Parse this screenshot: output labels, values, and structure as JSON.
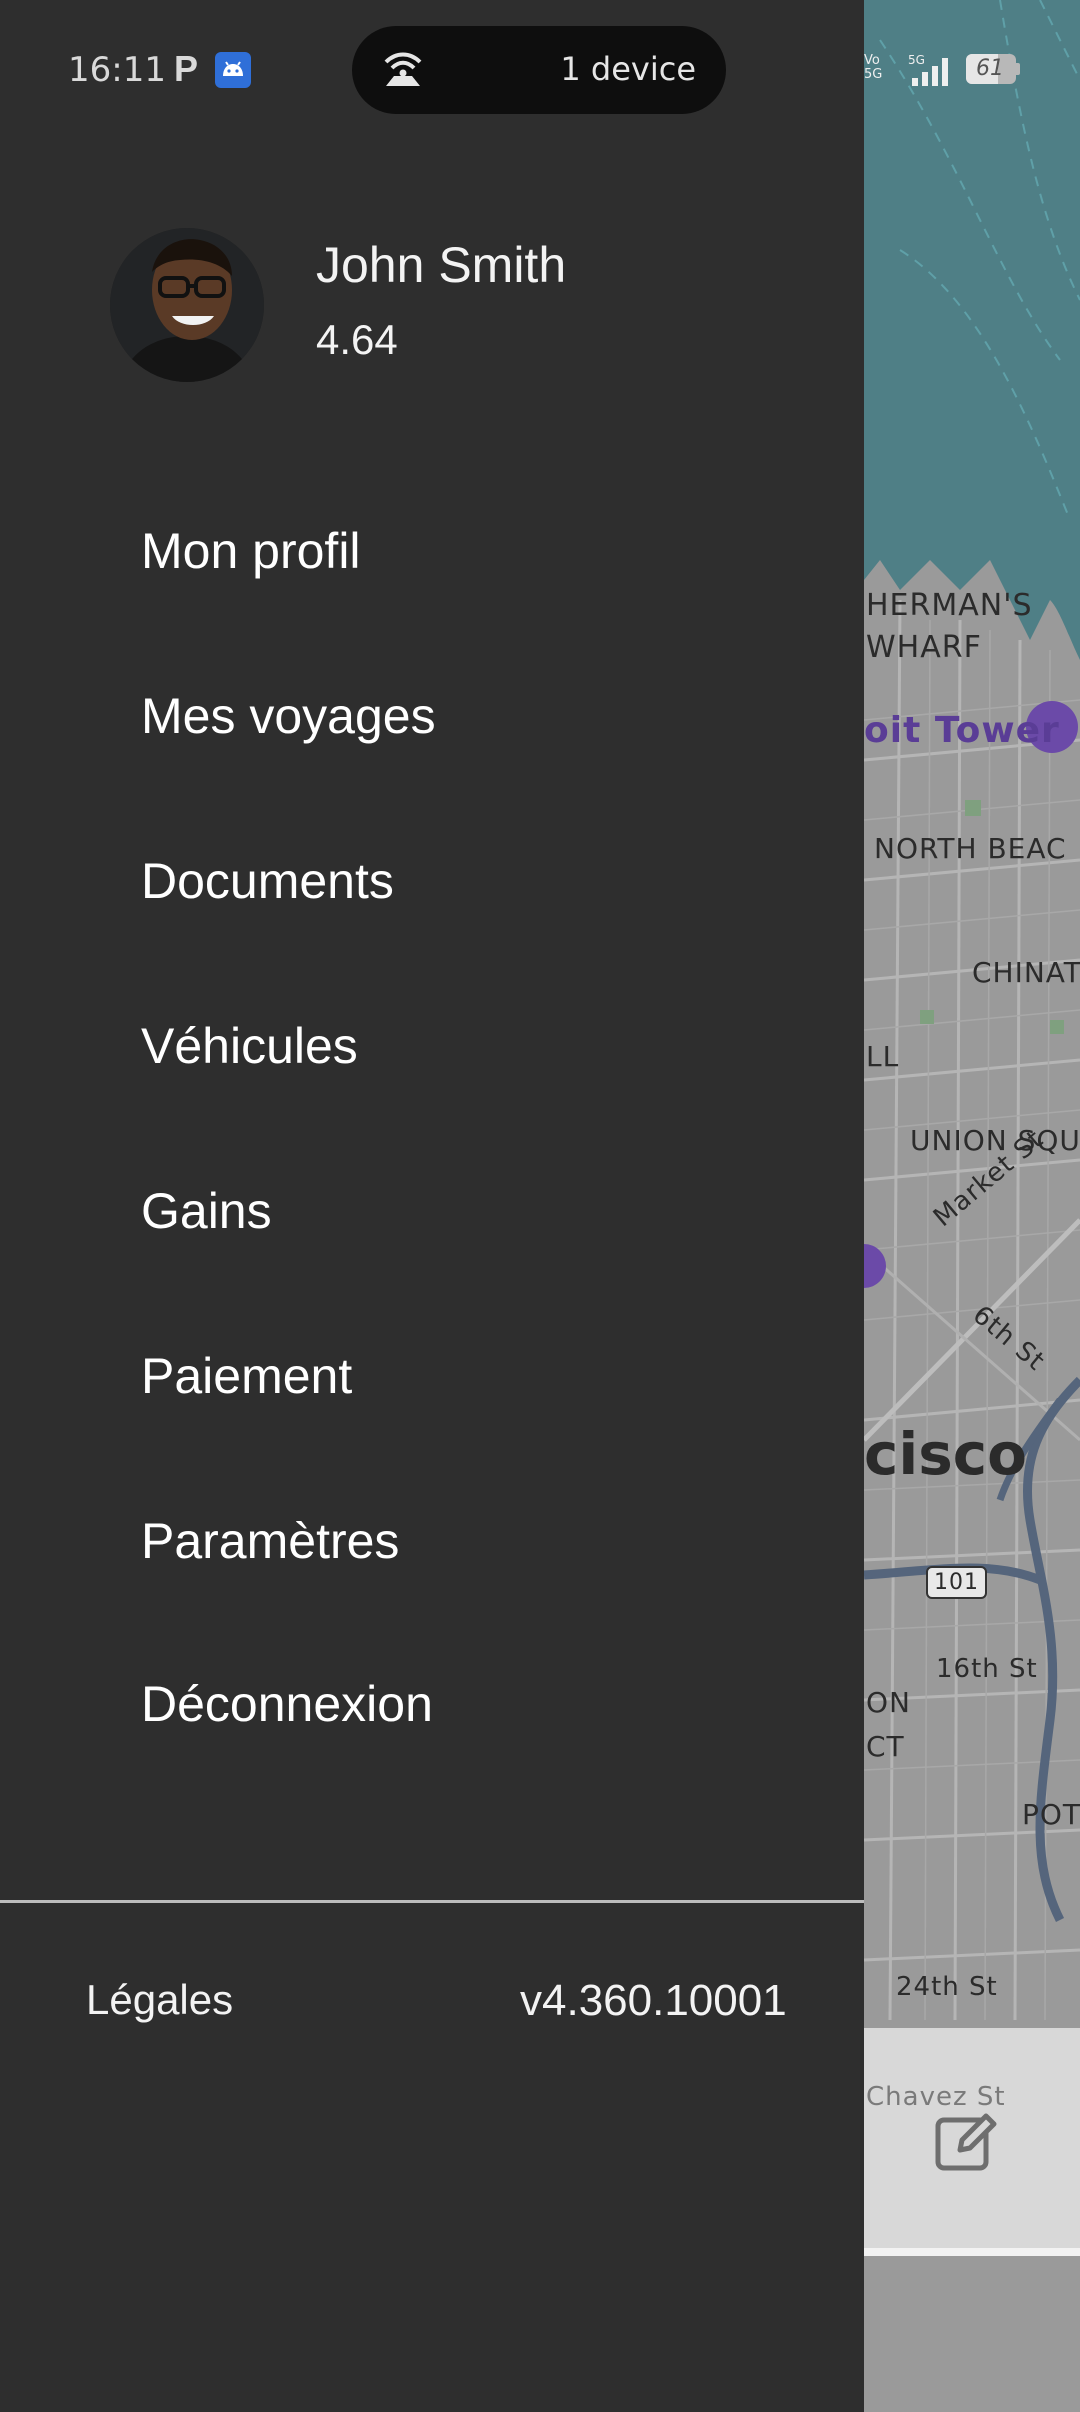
{
  "status_bar": {
    "time": "16:11",
    "notification_letter": "P",
    "island_text": "1 device",
    "battery": "61",
    "network": "5G",
    "volte": "Vo 5G"
  },
  "user": {
    "name": "John Smith",
    "rating": "4.64"
  },
  "menu": {
    "items": [
      {
        "label": "Mon profil"
      },
      {
        "label": "Mes voyages"
      },
      {
        "label": "Documents"
      },
      {
        "label": "Véhicules"
      },
      {
        "label": "Gains"
      },
      {
        "label": "Paiement"
      },
      {
        "label": "Paramètres"
      },
      {
        "label": "Déconnexion"
      }
    ]
  },
  "footer": {
    "legal_label": "Légales",
    "version": "v4.360.10001"
  },
  "map": {
    "labels": {
      "fishermans_wharf_1": "HERMAN'S",
      "fishermans_wharf_2": "WHARF",
      "coit_tower": "oit Tower",
      "north_beach": "NORTH BEAC",
      "chinatown": "CHINAT",
      "ll": "LL",
      "union_square": "UNION SQU",
      "market_st": "Market St",
      "sixth_st": "6th St",
      "city": "cisco",
      "highway_101": "101",
      "sixteenth_st": "16th St",
      "on": "ON",
      "ct": "CT",
      "pot": "POT",
      "twentyfourth_st": "24th St",
      "chavez_st": "Chavez St"
    }
  },
  "colors": {
    "drawer_bg": "#2e2e2e",
    "water": "#4f7f86",
    "land": "#9a9a9a",
    "poi": "#6b4aa8"
  }
}
